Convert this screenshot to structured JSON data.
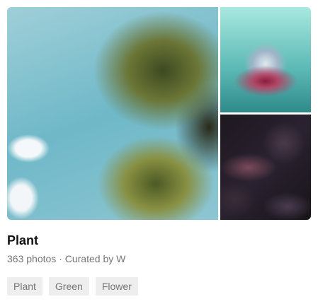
{
  "collection": {
    "title": "Plant",
    "photo_count": "363 photos",
    "separator": "·",
    "curator": "Curated by W",
    "tags": [
      "Plant",
      "Green",
      "Flower"
    ]
  }
}
